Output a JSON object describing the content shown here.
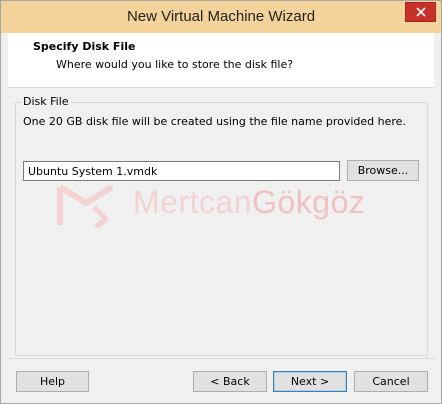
{
  "window": {
    "title": "New Virtual Machine Wizard"
  },
  "header": {
    "title": "Specify Disk File",
    "subtitle": "Where would you like to store the disk file?"
  },
  "group": {
    "label": "Disk File",
    "description": "One 20 GB disk file will be created using the file name provided here."
  },
  "file_input": {
    "value": "Ubuntu System 1.vmdk"
  },
  "buttons": {
    "browse": "Browse...",
    "help": "Help",
    "back": "< Back",
    "next": "Next >",
    "cancel": "Cancel"
  },
  "watermark": {
    "text_first": "Mertcan",
    "text_second": "Gökgöz"
  },
  "colors": {
    "titlebar": "#f3d399",
    "close_button": "#c7312a",
    "watermark": "#f4c8c8"
  }
}
